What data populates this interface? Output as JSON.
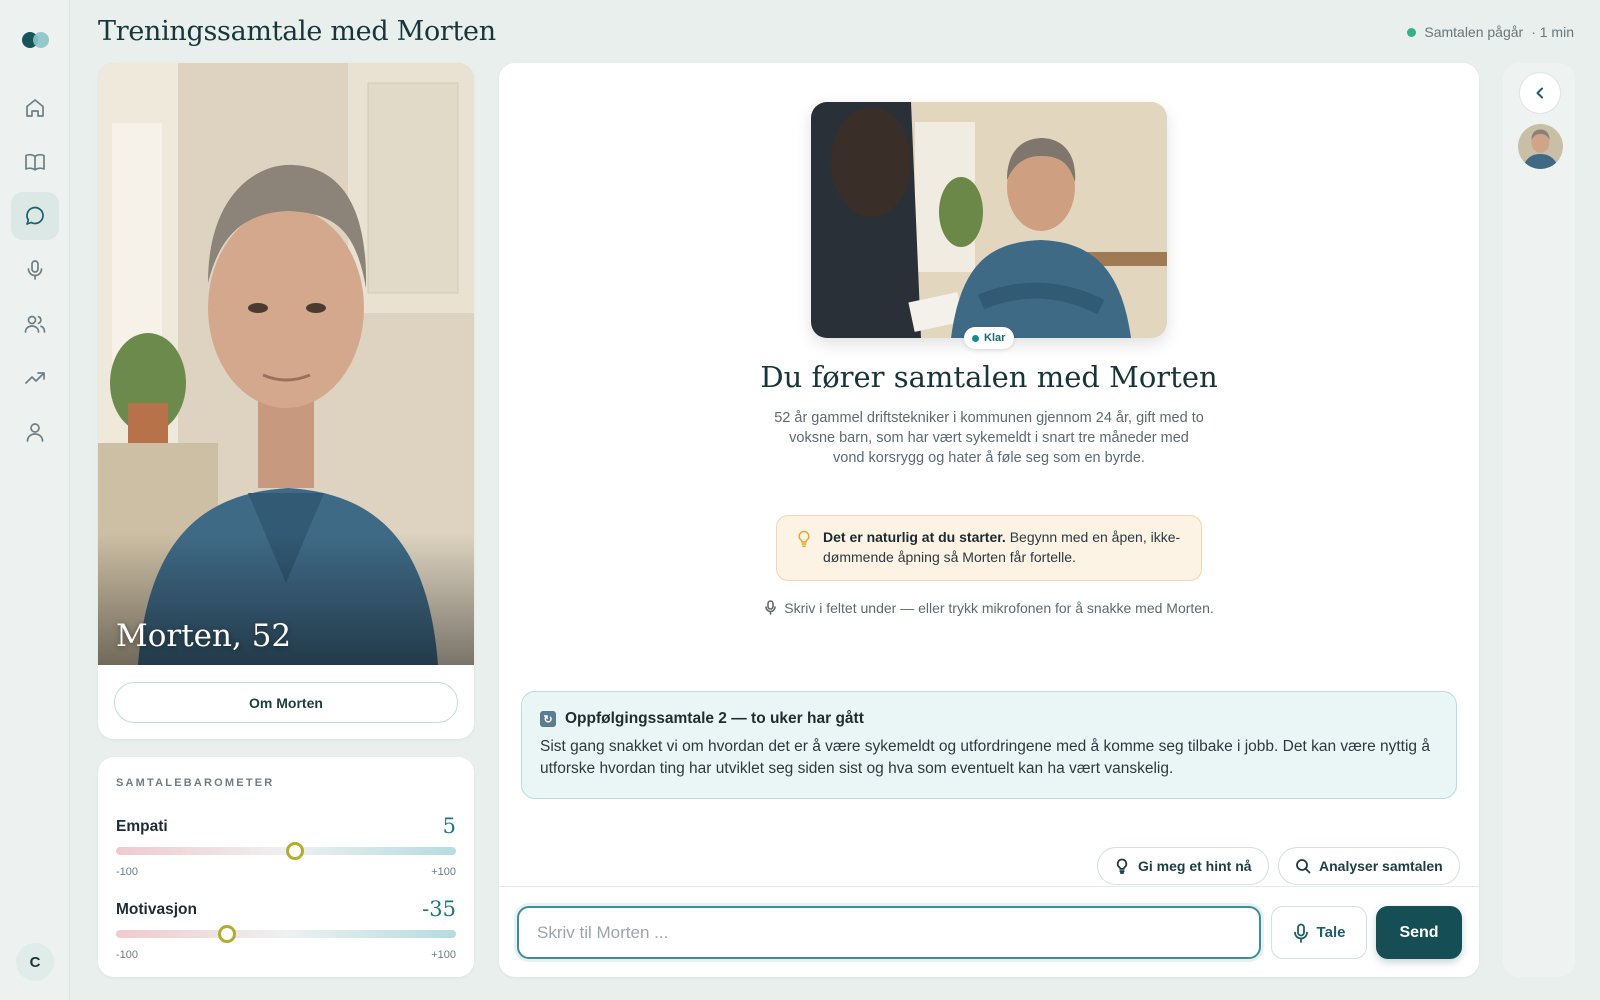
{
  "header": {
    "title": "Treningssamtale med Morten",
    "status": "Samtalen pågår",
    "duration": "· 1 min"
  },
  "sidebar": {
    "items": [
      {
        "name": "home-icon",
        "active": false
      },
      {
        "name": "book-icon",
        "active": false
      },
      {
        "name": "chat-icon",
        "active": true
      },
      {
        "name": "microphone-icon",
        "active": false
      },
      {
        "name": "users-icon",
        "active": false
      },
      {
        "name": "trending-up-icon",
        "active": false
      },
      {
        "name": "user-icon",
        "active": false
      }
    ],
    "user_initial": "C"
  },
  "profile": {
    "name_age": "Morten, 52",
    "about_label": "Om Morten"
  },
  "barometer": {
    "title": "SAMTALEBAROMETER",
    "metrics": [
      {
        "label": "Empati",
        "value": "5",
        "numeric": 5,
        "min": "-100",
        "max": "+100"
      },
      {
        "label": "Motivasjon",
        "value": "-35",
        "numeric": -35,
        "min": "-100",
        "max": "+100"
      }
    ]
  },
  "main": {
    "badge": "Klar",
    "title": "Du fører samtalen med Morten",
    "description": "52 år gammel driftstekniker i kommunen gjennom 24 år, gift med to voksne barn, som har vært sykemeldt i snart tre måneder med vond korsrygg og hater å føle seg som en byrde.",
    "tip_bold": "Det er naturlig at du starter.",
    "tip_text": " Begynn med en åpen, ikke-dømmende åpning så Morten får fortelle.",
    "instruction": "Skriv i feltet under — eller trykk mikrofonen for å snakke med Morten.",
    "followup": {
      "title": "Oppfølgingssamtale 2 — to uker har gått",
      "body": "Sist gang snakket vi om hvordan det er å være sykemeldt og utfordringene med å komme seg tilbake i jobb. Det kan være nyttig å utforske hvordan ting har utviklet seg siden sist og hva som eventuelt kan ha vært vanskelig."
    },
    "hint_label": "Gi meg et hint nå",
    "analyze_label": "Analyser samtalen"
  },
  "composer": {
    "placeholder": "Skriv til Morten ...",
    "voice_label": "Tale",
    "send_label": "Send"
  },
  "colors": {
    "accent": "#154e55",
    "status_green": "#2fb57f",
    "slider_thumb": "#b3ad2a"
  }
}
